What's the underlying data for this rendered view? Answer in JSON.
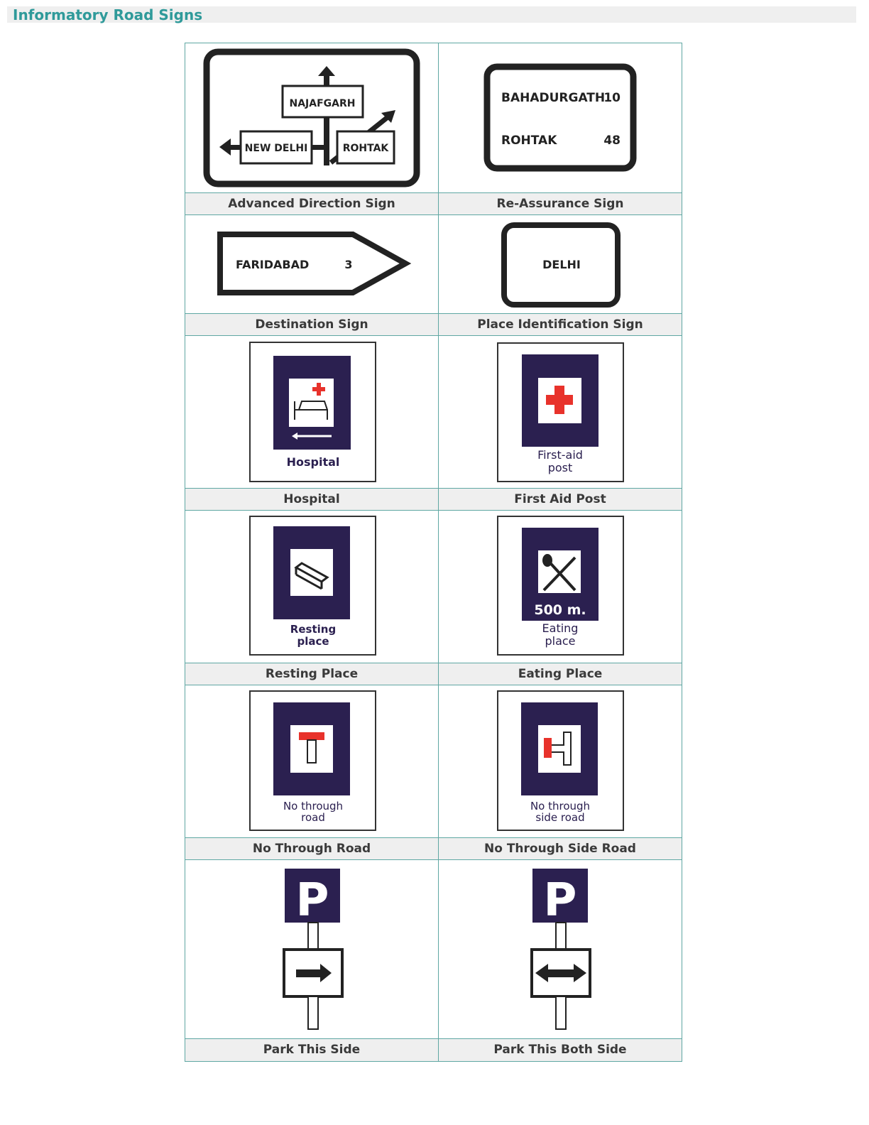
{
  "page": {
    "title": "Informatory Road Signs"
  },
  "colors": {
    "accent": "#2f9a9a",
    "sign_blue": "#2b2050",
    "first_aid_red": "#e8322b"
  },
  "signs": {
    "advanced_direction": {
      "caption": "Advanced Direction Sign",
      "north": "NAJAFGARH",
      "west": "NEW DELHI",
      "northeast": "ROHTAK"
    },
    "reassurance": {
      "caption": "Re-Assurance Sign",
      "line1_place": "BAHADURGATH",
      "line1_km": "10",
      "line2_place": "ROHTAK",
      "line2_km": "48"
    },
    "destination": {
      "caption": "Destination Sign",
      "place": "FARIDABAD",
      "km": "3"
    },
    "place_identification": {
      "caption": "Place Identification Sign",
      "place": "DELHI"
    },
    "hospital": {
      "caption": "Hospital",
      "sign_label": "Hospital"
    },
    "first_aid": {
      "caption": "First Aid Post",
      "sign_label_line1": "First-aid",
      "sign_label_line2": "post"
    },
    "resting": {
      "caption": "Resting Place",
      "sign_label_line1": "Resting",
      "sign_label_line2": "place"
    },
    "eating": {
      "caption": "Eating Place",
      "distance": "500 m.",
      "sign_label_line1": "Eating",
      "sign_label_line2": "place"
    },
    "no_through_road": {
      "caption": "No Through Road",
      "sign_label_line1": "No through",
      "sign_label_line2": "road"
    },
    "no_through_side_road": {
      "caption": "No Through Side Road",
      "sign_label_line1": "No through",
      "sign_label_line2": "side road"
    },
    "park_this_side": {
      "caption": "Park This Side",
      "letter": "P"
    },
    "park_both_side": {
      "caption": "Park This Both Side",
      "letter": "P"
    }
  }
}
